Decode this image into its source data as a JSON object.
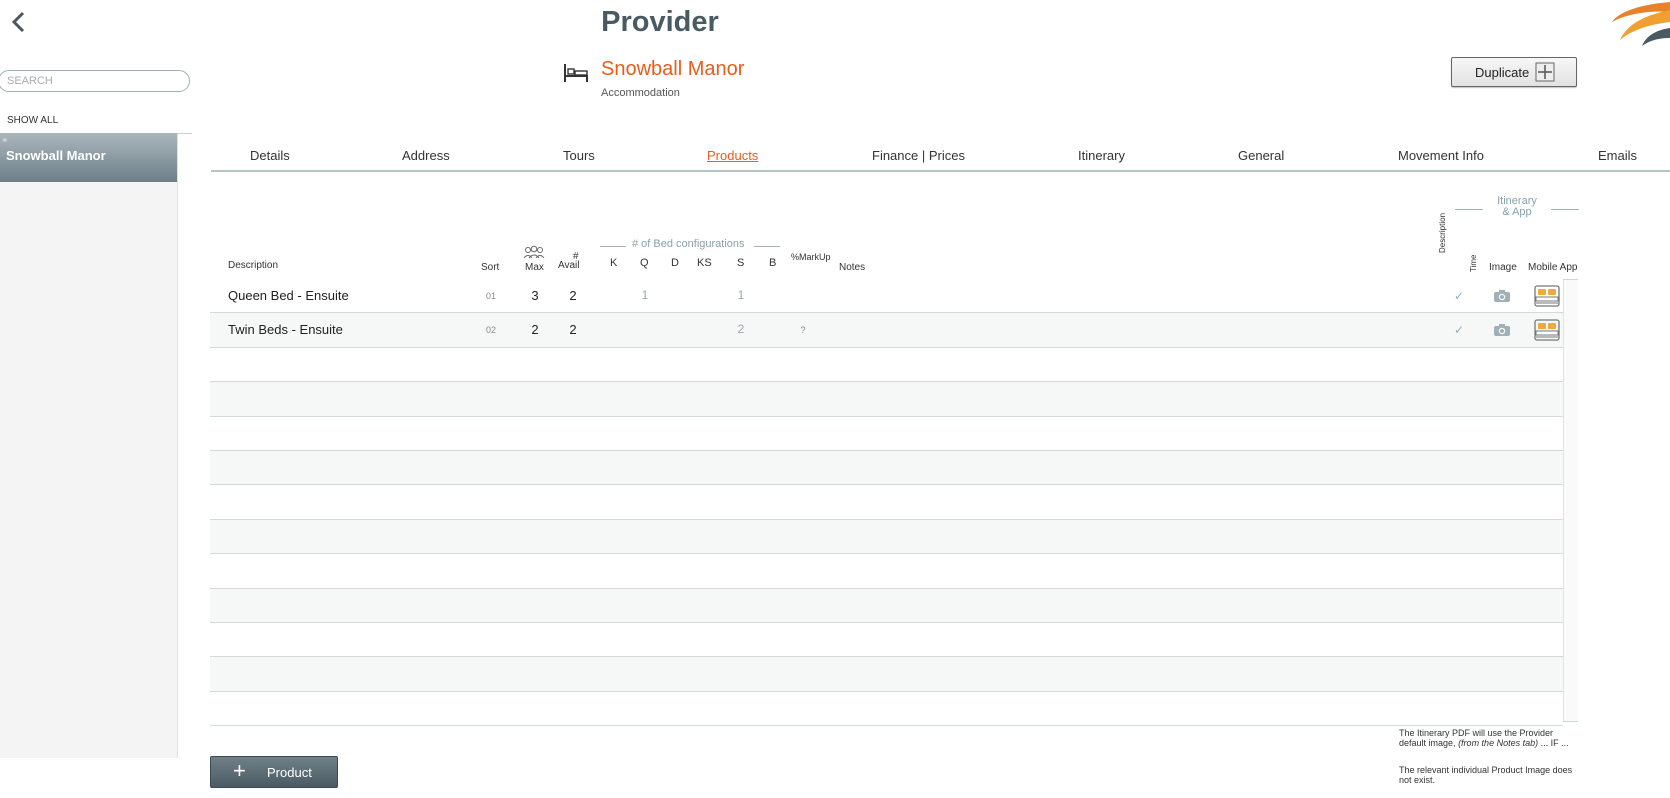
{
  "header": {
    "back_icon": "chevron-left-icon",
    "title": "Provider",
    "provider_icon": "bed-icon",
    "provider_name": "Snowball Manor",
    "provider_type": "Accommodation",
    "duplicate_label": "Duplicate",
    "duplicate_icon": "plus-square-icon",
    "logo": "brand-swoosh-logo"
  },
  "sidebar": {
    "search_placeholder": "SEARCH",
    "show_all": "SHOW ALL",
    "items": [
      {
        "label": "Snowball Manor",
        "selected": true
      }
    ]
  },
  "tabs": [
    {
      "label": "Details"
    },
    {
      "label": "Address"
    },
    {
      "label": "Tours"
    },
    {
      "label": "Products",
      "active": true
    },
    {
      "label": "Finance | Prices"
    },
    {
      "label": "Itinerary"
    },
    {
      "label": "General"
    },
    {
      "label": "Movement Info"
    },
    {
      "label": "Emails"
    }
  ],
  "columns": {
    "description": "Description",
    "sort": "Sort",
    "max": "Max",
    "max_icon": "people-group-icon",
    "avail_hash": "#",
    "avail": "Avail",
    "bed_group": "# of Bed configurations",
    "k": "K",
    "q": "Q",
    "d": "D",
    "ks": "KS",
    "s": "S",
    "b": "B",
    "markup": "%MarkUp",
    "notes": "Notes",
    "itin_group_line1": "Itinerary",
    "itin_group_line2": "& App",
    "itin_description": "Description",
    "itin_time": "Time",
    "image": "Image",
    "mobile_app": "Mobile App"
  },
  "products": [
    {
      "description": "Queen Bed - Ensuite",
      "sort": "01",
      "max": "3",
      "avail": "2",
      "k": "",
      "q": "1",
      "d": "",
      "ks": "",
      "s": "1",
      "b": "",
      "markup": "",
      "notes": "",
      "description_check": "✓",
      "image_icon": "camera-icon",
      "app_icon": "bed-app-icon"
    },
    {
      "description": "Twin Beds - Ensuite",
      "sort": "02",
      "max": "2",
      "avail": "2",
      "k": "",
      "q": "",
      "d": "",
      "ks": "",
      "s": "2",
      "b": "",
      "markup": "?",
      "notes": "",
      "description_check": "✓",
      "image_icon": "camera-icon",
      "app_icon": "bed-app-icon"
    }
  ],
  "add_product_label": "Product",
  "add_product_icon": "plus-icon",
  "footnote": {
    "line1": "The Itinerary PDF will use the Provider default image,",
    "line1_italic": "(from the Notes tab)",
    "line1_tail": "... IF ...",
    "line2": "The relevant individual Product Image does not exist."
  }
}
